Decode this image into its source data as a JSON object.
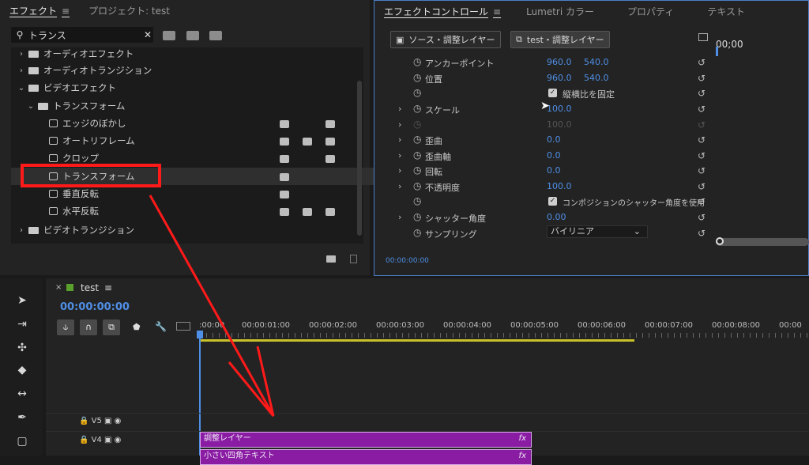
{
  "effects_panel": {
    "tabs": [
      {
        "label": "エフェクト"
      },
      {
        "label": "プロジェクト: test"
      }
    ],
    "search": {
      "value": "トランス"
    },
    "tree": [
      {
        "label": "オーディオエフェクト"
      },
      {
        "label": "オーディオトランジション"
      },
      {
        "label": "ビデオエフェクト"
      },
      {
        "label": "トランスフォーム"
      },
      {
        "label": "エッジのぼかし"
      },
      {
        "label": "オートリフレーム"
      },
      {
        "label": "クロップ"
      },
      {
        "label": "トランスフォーム"
      },
      {
        "label": "垂直反転"
      },
      {
        "label": "水平反転"
      },
      {
        "label": "ビデオトランジション"
      }
    ]
  },
  "effect_controls": {
    "tabs": [
      {
        "label": "エフェクトコントロール"
      },
      {
        "label": "Lumetri カラー"
      },
      {
        "label": "プロパティ"
      },
      {
        "label": "テキスト"
      }
    ],
    "source_button": "ソース・調整レイヤー",
    "sequence_button": "test・調整レイヤー",
    "mini_timecode": "00;00",
    "properties": {
      "anchor": {
        "name": "アンカーポイント",
        "x": "960.0",
        "y": "540.0"
      },
      "position": {
        "name": "位置",
        "x": "960.0",
        "y": "540.0"
      },
      "uniform_scale": {
        "label": "縦横比を固定"
      },
      "scale": {
        "name": "スケール",
        "value": "100.0"
      },
      "scale_width": {
        "value": "100.0"
      },
      "skew": {
        "name": "歪曲",
        "value": "0.0"
      },
      "skew_axis": {
        "name": "歪曲軸",
        "value": "0.0"
      },
      "rotation": {
        "name": "回転",
        "value": "0.0"
      },
      "opacity": {
        "name": "不透明度",
        "value": "100.0"
      },
      "comp_shutter": {
        "label": "コンポジションのシャッター角度を使用"
      },
      "shutter_angle": {
        "name": "シャッター角度",
        "value": "0.00"
      },
      "sampling": {
        "name": "サンプリング",
        "value": "バイリニア"
      }
    },
    "footer_timecode": "00:00:00:00"
  },
  "timeline": {
    "sequence_name": "test",
    "timecode": "00:00:00:00",
    "ruler": [
      ":00:00",
      "00:00:01:00",
      "00:00:02:00",
      "00:00:03:00",
      "00:00:04:00",
      "00:00:05:00",
      "00:00:06:00",
      "00:00:07:00",
      "00:00:08:00",
      "00:00"
    ],
    "tracks": [
      {
        "name": "V5"
      },
      {
        "name": "V4"
      }
    ],
    "clips": [
      {
        "label": "調整レイヤー",
        "fx": "fx"
      },
      {
        "label": "小さい四角テキスト",
        "fx": "fx"
      }
    ]
  },
  "colors": {
    "highlight": "#ff1a1a",
    "clip": "#8a1ca4",
    "accent": "#4f8fe6"
  }
}
